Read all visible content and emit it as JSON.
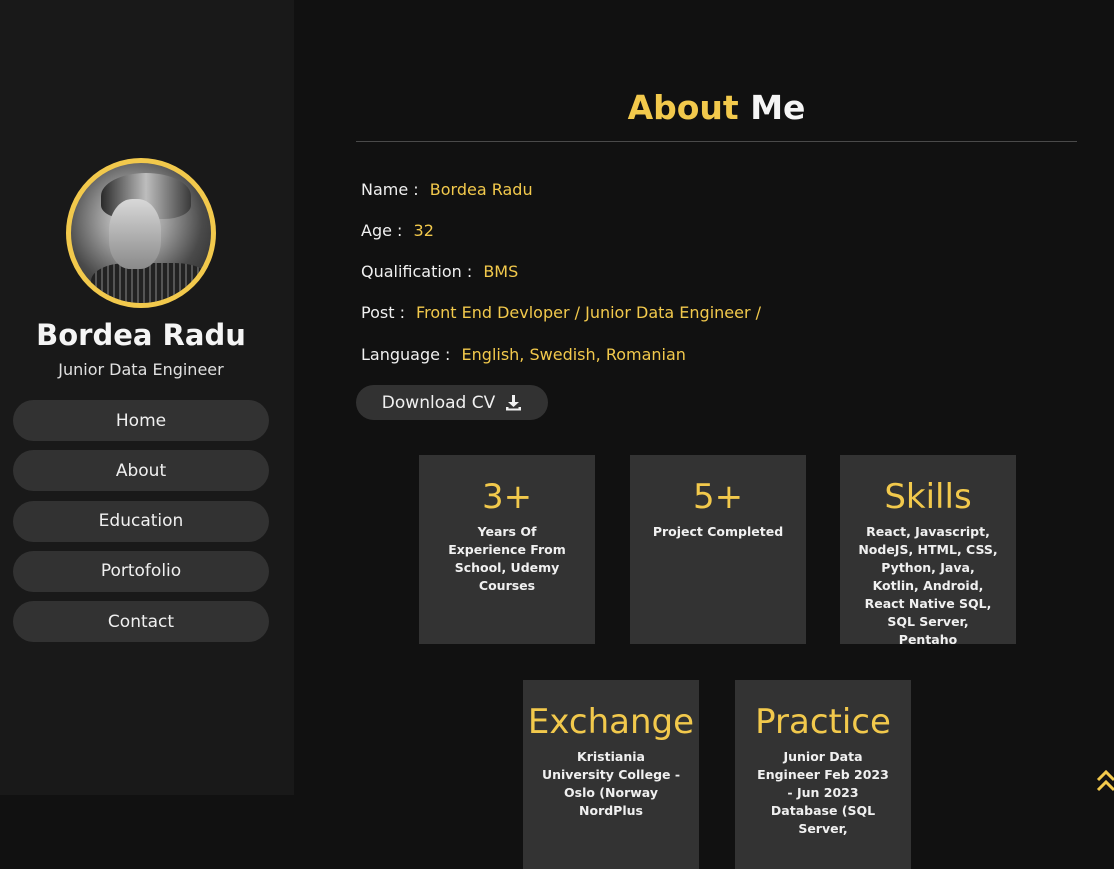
{
  "profile": {
    "name": "Bordea Radu",
    "role": "Junior Data Engineer"
  },
  "nav": {
    "items": [
      {
        "label": "Home"
      },
      {
        "label": "About"
      },
      {
        "label": "Education"
      },
      {
        "label": "Portofolio"
      },
      {
        "label": "Contact"
      }
    ]
  },
  "about": {
    "heading_accent": "About",
    "heading_rest": "Me",
    "info": [
      {
        "label": "Name :",
        "value": "Bordea Radu"
      },
      {
        "label": "Age :",
        "value": "32"
      },
      {
        "label": "Qualification :",
        "value": "BMS"
      },
      {
        "label": "Post :",
        "value": "Front End Devloper / Junior Data Engineer /"
      },
      {
        "label": "Language :",
        "value": "English, Swedish, Romanian"
      }
    ],
    "download_label": "Download CV",
    "download_icon": "download-icon"
  },
  "cards": [
    {
      "big": "3+",
      "desc": "Years Of Experience From School, Udemy Courses"
    },
    {
      "big": "5+",
      "desc": "Project Completed"
    },
    {
      "big": "Skills",
      "desc": "React, Javascript, NodeJS, HTML, CSS, Python, Java, Kotlin, Android, React Native SQL, SQL Server, Pentaho"
    },
    {
      "big": "Exchange",
      "desc": "Kristiania University College - Oslo (Norway NordPlus"
    },
    {
      "big": "Practice",
      "desc": "Junior Data Engineer Feb 2023 - Jun 2023 Database (SQL Server,"
    }
  ],
  "colors": {
    "accent": "#f2c94c",
    "sidebar_bg": "#191919",
    "main_bg": "#111111",
    "card_bg": "#333333",
    "button_bg": "#323232"
  },
  "icons": {
    "scroll_top": "double-chevron-up-icon"
  }
}
